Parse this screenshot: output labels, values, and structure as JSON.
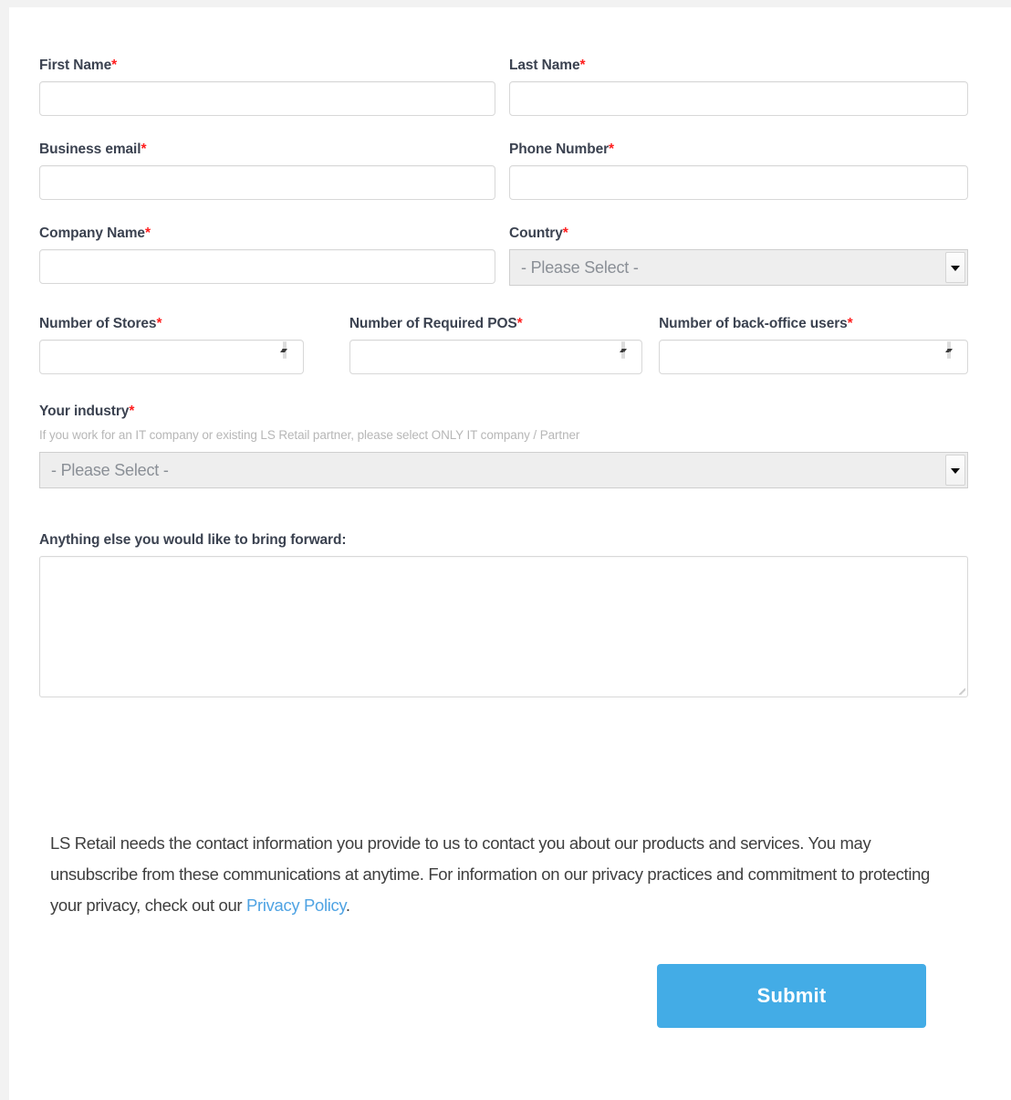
{
  "form": {
    "required_marker": "*",
    "rows": {
      "row1": [
        {
          "label": "First Name",
          "required": true,
          "type": "text",
          "value": ""
        },
        {
          "label": "Last Name",
          "required": true,
          "type": "text",
          "value": ""
        }
      ],
      "row2": [
        {
          "label": "Business email",
          "required": true,
          "type": "text",
          "value": ""
        },
        {
          "label": "Phone Number",
          "required": true,
          "type": "text",
          "value": ""
        }
      ],
      "row3": [
        {
          "label": "Company Name",
          "required": true,
          "type": "text",
          "value": ""
        },
        {
          "label": "Country",
          "required": true,
          "type": "select",
          "value": "- Please Select -"
        }
      ],
      "row4": [
        {
          "label": "Number of Stores",
          "required": true,
          "type": "number",
          "value": ""
        },
        {
          "label": "Number of Required POS",
          "required": true,
          "type": "number",
          "value": ""
        },
        {
          "label": "Number of back-office users",
          "required": true,
          "type": "number",
          "value": ""
        }
      ]
    },
    "industry": {
      "label": "Your industry",
      "required": true,
      "helper": "If you work for an IT company or existing LS Retail partner, please select ONLY IT company / Partner",
      "value": "- Please Select -"
    },
    "comments": {
      "label": "Anything else you would like to bring forward:",
      "required": false,
      "value": ""
    },
    "privacy": {
      "text_before": "LS Retail needs the contact information you provide to us to contact you about our products and services. You may unsubscribe from these communications at anytime. For information on our privacy practices and commitment to protecting your privacy, check out our ",
      "link_label": "Privacy Policy",
      "text_after": "."
    },
    "submit_label": "Submit"
  },
  "colors": {
    "page_background": "#f2f2f2",
    "card_background": "#ffffff",
    "label": "#3b4250",
    "required_asterisk": "#ff1f1f",
    "helper_text": "#b7b7b7",
    "input_border": "#d8d8d8",
    "select_background": "#eeeeee",
    "select_text": "#8a8f96",
    "link": "#4fa3e3",
    "submit_background": "#43ace6",
    "submit_text": "#ffffff",
    "body_text": "#3f3f3f"
  },
  "icons": {
    "select_arrow": "chevron-down-icon",
    "spinner_up": "spinner-up-icon",
    "spinner_down": "spinner-down-icon",
    "resize_grip": "resize-grip-icon"
  }
}
